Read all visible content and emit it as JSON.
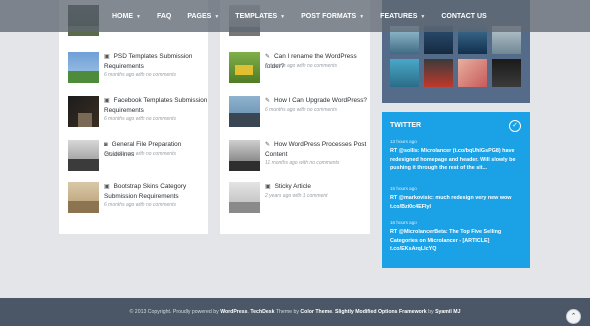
{
  "nav": {
    "items": [
      {
        "label": "HOME",
        "dropdown": true
      },
      {
        "label": "FAQ",
        "dropdown": false
      },
      {
        "label": "PAGES",
        "dropdown": true
      },
      {
        "label": "TEMPLATES",
        "dropdown": true
      },
      {
        "label": "POST FORMATS",
        "dropdown": true
      },
      {
        "label": "FEATURES",
        "dropdown": true
      },
      {
        "label": "CONTACT US",
        "dropdown": false
      }
    ]
  },
  "left_posts": [
    {
      "title": "",
      "meta": "",
      "icon": "image-icon"
    },
    {
      "title": "PSD Templates Submission Requirements",
      "meta": "6 months ago with no comments",
      "icon": "image-icon"
    },
    {
      "title": "Facebook Templates Submission Requirements",
      "meta": "6 months ago with no comments",
      "icon": "image-icon"
    },
    {
      "title": "General File Preparation Guidelines",
      "meta": "6 months ago with no comments",
      "icon": "camera-icon"
    },
    {
      "title": "Bootstrap Skins Category Submission Requirements",
      "meta": "6 months ago with no comments",
      "icon": "image-icon"
    }
  ],
  "mid_posts": [
    {
      "title": "",
      "meta": "",
      "icon": "pencil-icon"
    },
    {
      "title": "Can I rename the WordPress folder?",
      "meta": "6 months ago with no comments",
      "icon": "pencil-icon"
    },
    {
      "title": "How I Can Upgrade WordPress?",
      "meta": "6 months ago with no comments",
      "icon": "pencil-icon"
    },
    {
      "title": "How WordPress Processes Post Content",
      "meta": "11 months ago with no comments",
      "icon": "pencil-icon"
    },
    {
      "title": "Sticky Article",
      "meta": "2 years ago with 1 comment",
      "icon": "image-icon"
    }
  ],
  "twitter": {
    "title": "TWITTER",
    "tweets": [
      {
        "time": "13 hours ago",
        "text": "RT @sollis: Microlancer (t.co/bqUhIGsPG8) have redesigned homepage and header. Will slowly be pushing it through the rest of the sit..."
      },
      {
        "time": "15 hours ago",
        "text": "RT @markovisic: much redesign very new wow t.co/Bzi0c4EFlyl"
      },
      {
        "time": "16 hours ago",
        "text": "RT @MicrolancerBeta: The Top Five Selling Categories on Microlancer - [ARTICLE] t.co/EKsArqLlcYQ"
      }
    ]
  },
  "footer": {
    "prefix": "© 2013 Copyright. Proudly powered by",
    "wp": "WordPress",
    "sep": ".",
    "theme_name": "TechDesk",
    "theme_word": "Theme by",
    "author": "Color Theme",
    "modified": "Slightly Modified Options Framework",
    "by": "by",
    "syamil": "Syamil MJ"
  },
  "colors": {
    "nav_bg": "#606872",
    "flickr_bg": "#546c8a",
    "twitter_bg": "#1ba1e6",
    "footer_bg": "#4b5767"
  }
}
